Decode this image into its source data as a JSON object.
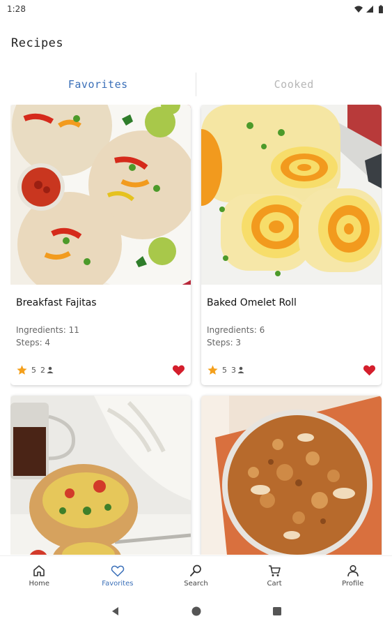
{
  "status_bar": {
    "time": "1:28",
    "icons": [
      "wifi-icon",
      "cellular-signal-icon",
      "battery-icon"
    ]
  },
  "app": {
    "title": "Recipes"
  },
  "tabs": [
    {
      "label": "Favorites",
      "active": true
    },
    {
      "label": "Cooked",
      "active": false
    }
  ],
  "colors": {
    "accent": "#3a6fb8",
    "star": "#f4a01c",
    "heart": "#d41e2c",
    "inactive_tab": "#b6b6b6"
  },
  "recipes": [
    {
      "title": "Breakfast Fajitas",
      "ingredients_text": "Ingredients: 11",
      "steps_text": "Steps: 4",
      "rating": "5",
      "ratings_count": "2",
      "favorite": true,
      "image": "breakfast-fajitas-photo"
    },
    {
      "title": "Baked Omelet Roll",
      "ingredients_text": "Ingredients: 6",
      "steps_text": "Steps: 3",
      "rating": "5",
      "ratings_count": "3",
      "favorite": true,
      "image": "baked-omelet-roll-photo"
    },
    {
      "image": "stuffed-bread-bowl-photo"
    },
    {
      "image": "granola-bowl-photo"
    }
  ],
  "bottom_nav": [
    {
      "label": "Home",
      "icon": "home-icon",
      "active": false
    },
    {
      "label": "Favorites",
      "icon": "heart-outline-icon",
      "active": true
    },
    {
      "label": "Search",
      "icon": "search-icon",
      "active": false
    },
    {
      "label": "Cart",
      "icon": "cart-icon",
      "active": false
    },
    {
      "label": "Profile",
      "icon": "profile-icon",
      "active": false
    }
  ],
  "system_nav": [
    "back-icon",
    "home-circle-icon",
    "recents-icon"
  ]
}
